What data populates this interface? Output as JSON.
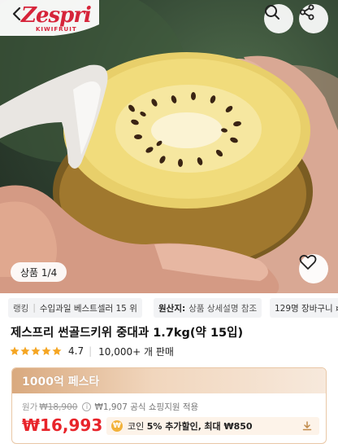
{
  "header": {
    "logo_text": "Zespri",
    "logo_subtext": "KIWIFRUIT"
  },
  "image": {
    "page_indicator": "상품 1/4"
  },
  "chips": [
    {
      "label": "랭킹",
      "value": "수입과일 베스트셀러 15 위"
    },
    {
      "label": "원산지:",
      "value": "상품 상세설명 참조"
    },
    {
      "label": "",
      "value": "129명 장바구니 ¤"
    }
  ],
  "product": {
    "title": "제스프리 썬골드키위 중대과 1.7kg(약 15입)",
    "rating": "4.7",
    "review_count": "10,000+ 개 판매",
    "star_color": "#f5a623"
  },
  "promo": {
    "banner": "1000억 페스타",
    "original_label": "원가",
    "original_price": "₩18,900",
    "support_text": "₩1,907 공식 쇼핑지원 적용",
    "price": "₩16,993",
    "coin_text_prefix": "코인",
    "coin_discount": "5% 추가할인,",
    "coin_max": "최대 ₩850",
    "price_color": "#e8242a"
  },
  "icons": [
    "back-arrow-icon",
    "search-icon",
    "share-icon",
    "heart-icon",
    "info-icon",
    "coin-icon",
    "download-icon",
    "star-icon"
  ]
}
